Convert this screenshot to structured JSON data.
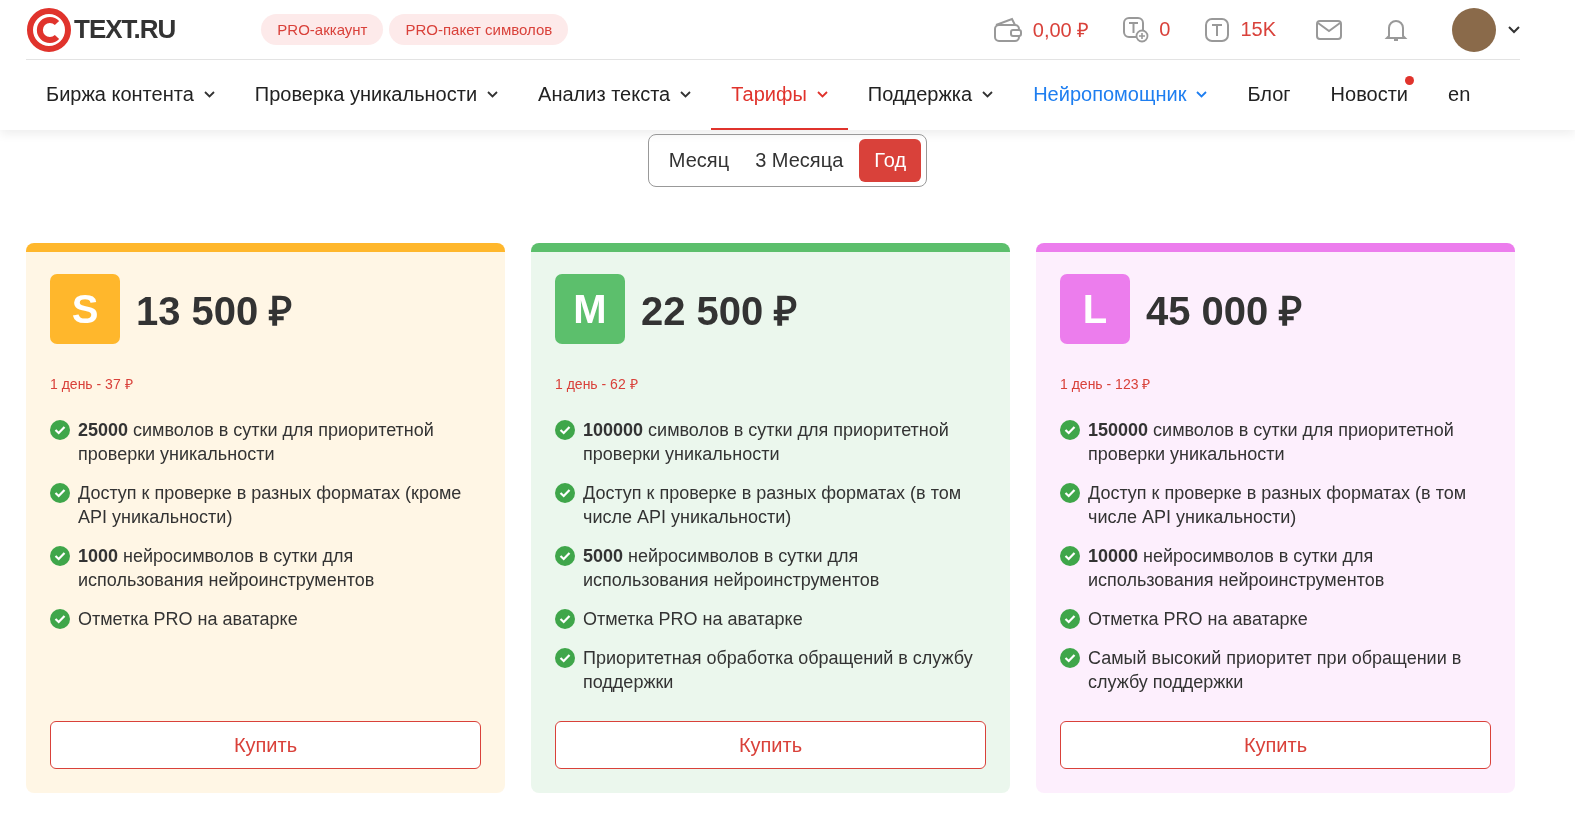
{
  "logo": {
    "text": "TEXT.RU"
  },
  "pro_links": [
    "PRO-аккаунт",
    "PRO-пакет символов"
  ],
  "stats": [
    {
      "kind": "wallet",
      "value": "0,00 ₽"
    },
    {
      "kind": "plus-t",
      "value": "0"
    },
    {
      "kind": "t",
      "value": "15K"
    }
  ],
  "nav": [
    {
      "label": "Биржа контента",
      "dropdown": true,
      "selected": false,
      "highlighted": false,
      "badge": false
    },
    {
      "label": "Проверка уникальности",
      "dropdown": true,
      "selected": false,
      "highlighted": false,
      "badge": false
    },
    {
      "label": "Анализ текста",
      "dropdown": true,
      "selected": false,
      "highlighted": false,
      "badge": false
    },
    {
      "label": "Тарифы",
      "dropdown": true,
      "selected": true,
      "highlighted": false,
      "badge": false
    },
    {
      "label": "Поддержка",
      "dropdown": true,
      "selected": false,
      "highlighted": false,
      "badge": false
    },
    {
      "label": "Нейропомощник",
      "dropdown": true,
      "selected": false,
      "highlighted": true,
      "badge": false
    },
    {
      "label": "Блог",
      "dropdown": false,
      "selected": false,
      "highlighted": false,
      "badge": false
    },
    {
      "label": "Новости",
      "dropdown": false,
      "selected": false,
      "highlighted": false,
      "badge": true
    },
    {
      "label": "en",
      "dropdown": false,
      "selected": false,
      "highlighted": false,
      "badge": false
    }
  ],
  "periods": [
    {
      "label": "Месяц",
      "selected": false
    },
    {
      "label": "3 Месяца",
      "selected": false
    },
    {
      "label": "Год",
      "selected": true
    }
  ],
  "plans": [
    {
      "letter": "S",
      "color": "#ffb72c",
      "price": "13 500 ₽",
      "per_day": "1 день - 37 ₽",
      "features": [
        "**25000** символов в сутки для приоритетной проверки уникальности",
        "Доступ к проверке в разных форматах (кроме API уникальности)",
        "**1000** нейросимволов в сутки для использования нейроинструментов",
        "Отметка PRO на аватарке"
      ],
      "button": "Купить"
    },
    {
      "letter": "M",
      "color": "#5cbf6c",
      "price": "22 500 ₽",
      "per_day": "1 день - 62 ₽",
      "features": [
        "**100000** символов в сутки для приоритетной проверки уникальности",
        "Доступ к проверке в разных форматах (в том числе API уникальности)",
        "**5000** нейросимволов в сутки для использования нейроинструментов",
        "Отметка PRO на аватарке",
        "Приоритетная обработка обращений в службу поддержки"
      ],
      "button": "Купить"
    },
    {
      "letter": "L",
      "color": "#ec7ded",
      "price": "45 000 ₽",
      "per_day": "1 день - 123 ₽",
      "features": [
        "**150000** символов в сутки для приоритетной проверки уникальности",
        "Доступ к проверке в разных форматах (в том числе API уникальности)",
        "**10000** нейросимволов в сутки для использования нейроинструментов",
        "Отметка PRO на аватарке",
        "Самый высокий приоритет при обращении в службу поддержки"
      ],
      "button": "Купить"
    }
  ]
}
